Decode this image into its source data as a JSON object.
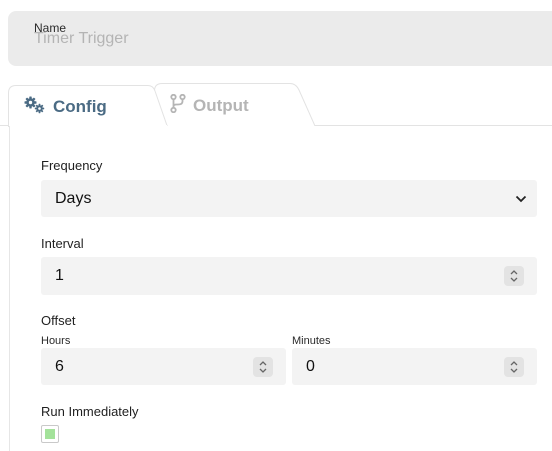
{
  "name_field": {
    "label": "Name",
    "value": "Timer Trigger"
  },
  "tabs": [
    {
      "label": "Config",
      "icon": "cogs-icon",
      "active": true
    },
    {
      "label": "Output",
      "icon": "fork-icon",
      "active": false
    }
  ],
  "frequency": {
    "label": "Frequency",
    "value": "Days"
  },
  "interval": {
    "label": "Interval",
    "value": "1"
  },
  "offset": {
    "label": "Offset",
    "hours": {
      "label": "Hours",
      "value": "6"
    },
    "minutes": {
      "label": "Minutes",
      "value": "0"
    }
  },
  "run_immediately": {
    "label": "Run Immediately",
    "checked": false
  },
  "colors": {
    "accent": "#4b6b84",
    "checkbox_fill": "#a3e29a",
    "input_bg": "#f3f3f3"
  }
}
